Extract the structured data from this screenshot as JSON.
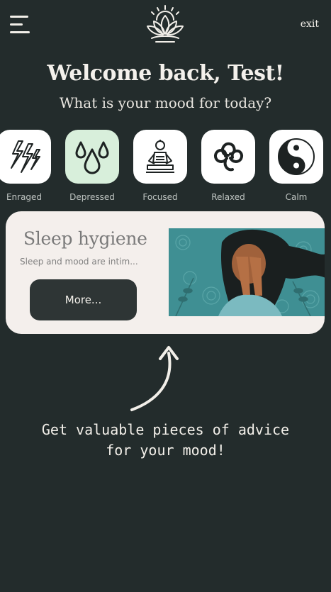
{
  "header": {
    "menu_icon": "hamburger-menu-icon",
    "logo_icon": "lotus-sun-logo-icon",
    "exit_label": "exit"
  },
  "welcome": {
    "title": "Welcome back, Test!",
    "subtitle": "What is your mood for today?"
  },
  "moods": [
    {
      "label": "Enraged",
      "icon": "lightning-icon",
      "selected": false
    },
    {
      "label": "Depressed",
      "icon": "drops-icon",
      "selected": true
    },
    {
      "label": "Focused",
      "icon": "meditating-figure-icon",
      "selected": false
    },
    {
      "label": "Relaxed",
      "icon": "triskelion-icon",
      "selected": false
    },
    {
      "label": "Calm",
      "icon": "yin-yang-icon",
      "selected": false
    }
  ],
  "advice_card": {
    "title": "Sleep hygiene",
    "description": "Sleep and mood are intim...",
    "button_label": "More..."
  },
  "hint": {
    "text": "Get valuable pieces of advice\nfor your mood!"
  },
  "colors": {
    "background": "#232c2c",
    "card": "#f4efec",
    "button": "#2e3535",
    "selected_tile": "#d8efdb",
    "teal_illustration": "#3f8f93"
  }
}
